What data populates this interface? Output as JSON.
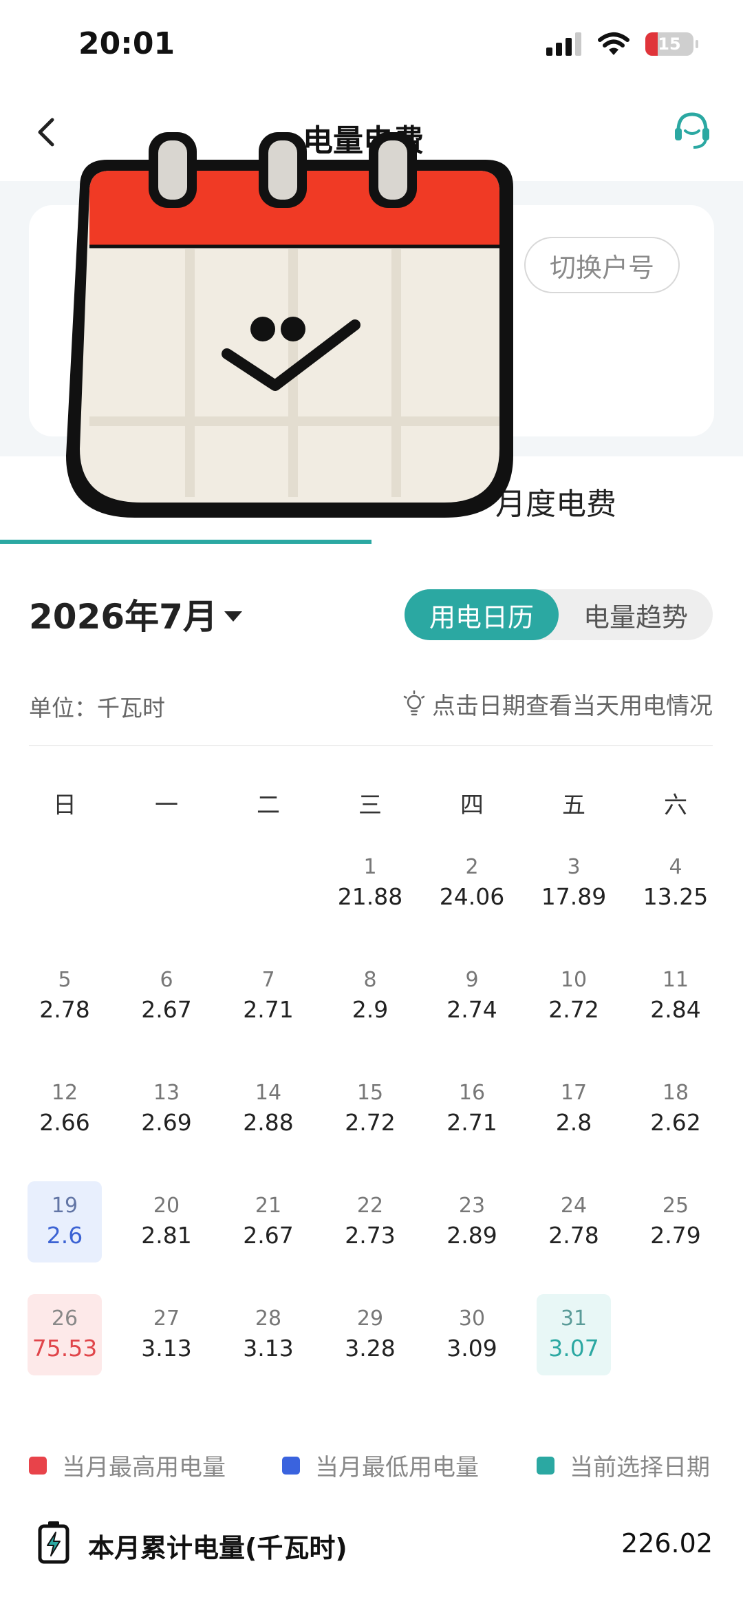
{
  "status_bar": {
    "time": "20:01",
    "battery": "15"
  },
  "header": {
    "title": "电量电费"
  },
  "account": {
    "switch_label": "切换户号"
  },
  "tabs": {
    "monthly": "月度电费"
  },
  "calendar_header": {
    "month": "2026年7月",
    "view_calendar": "用电日历",
    "view_trend": "电量趋势"
  },
  "unit": "单位：千瓦时",
  "hint": "点击日期查看当天用电情况",
  "weekdays": [
    "日",
    "一",
    "二",
    "三",
    "四",
    "五",
    "六"
  ],
  "days": [
    {
      "d": "1",
      "v": "21.88"
    },
    {
      "d": "2",
      "v": "24.06"
    },
    {
      "d": "3",
      "v": "17.89"
    },
    {
      "d": "4",
      "v": "13.25"
    },
    {
      "d": "5",
      "v": "2.78"
    },
    {
      "d": "6",
      "v": "2.67"
    },
    {
      "d": "7",
      "v": "2.71"
    },
    {
      "d": "8",
      "v": "2.9"
    },
    {
      "d": "9",
      "v": "2.74"
    },
    {
      "d": "10",
      "v": "2.72"
    },
    {
      "d": "11",
      "v": "2.84"
    },
    {
      "d": "12",
      "v": "2.66"
    },
    {
      "d": "13",
      "v": "2.69"
    },
    {
      "d": "14",
      "v": "2.88"
    },
    {
      "d": "15",
      "v": "2.72"
    },
    {
      "d": "16",
      "v": "2.71"
    },
    {
      "d": "17",
      "v": "2.8"
    },
    {
      "d": "18",
      "v": "2.62"
    },
    {
      "d": "19",
      "v": "2.6"
    },
    {
      "d": "20",
      "v": "2.81"
    },
    {
      "d": "21",
      "v": "2.67"
    },
    {
      "d": "22",
      "v": "2.73"
    },
    {
      "d": "23",
      "v": "2.89"
    },
    {
      "d": "24",
      "v": "2.78"
    },
    {
      "d": "25",
      "v": "2.79"
    },
    {
      "d": "26",
      "v": "75.53"
    },
    {
      "d": "27",
      "v": "3.13"
    },
    {
      "d": "28",
      "v": "3.13"
    },
    {
      "d": "29",
      "v": "3.28"
    },
    {
      "d": "30",
      "v": "3.09"
    },
    {
      "d": "31",
      "v": "3.07"
    }
  ],
  "highlights": {
    "highest_day": "26",
    "lowest_day": "19",
    "selected_day": "31"
  },
  "legend": {
    "highest": "当月最高用电量",
    "lowest": "当月最低用电量",
    "selected": "当前选择日期"
  },
  "colors": {
    "accent": "#2ba8a2",
    "highest": "#e0454a",
    "lowest": "#3c63d3"
  },
  "total": {
    "label": "本月累计电量(千瓦时)",
    "value": "226.02"
  }
}
